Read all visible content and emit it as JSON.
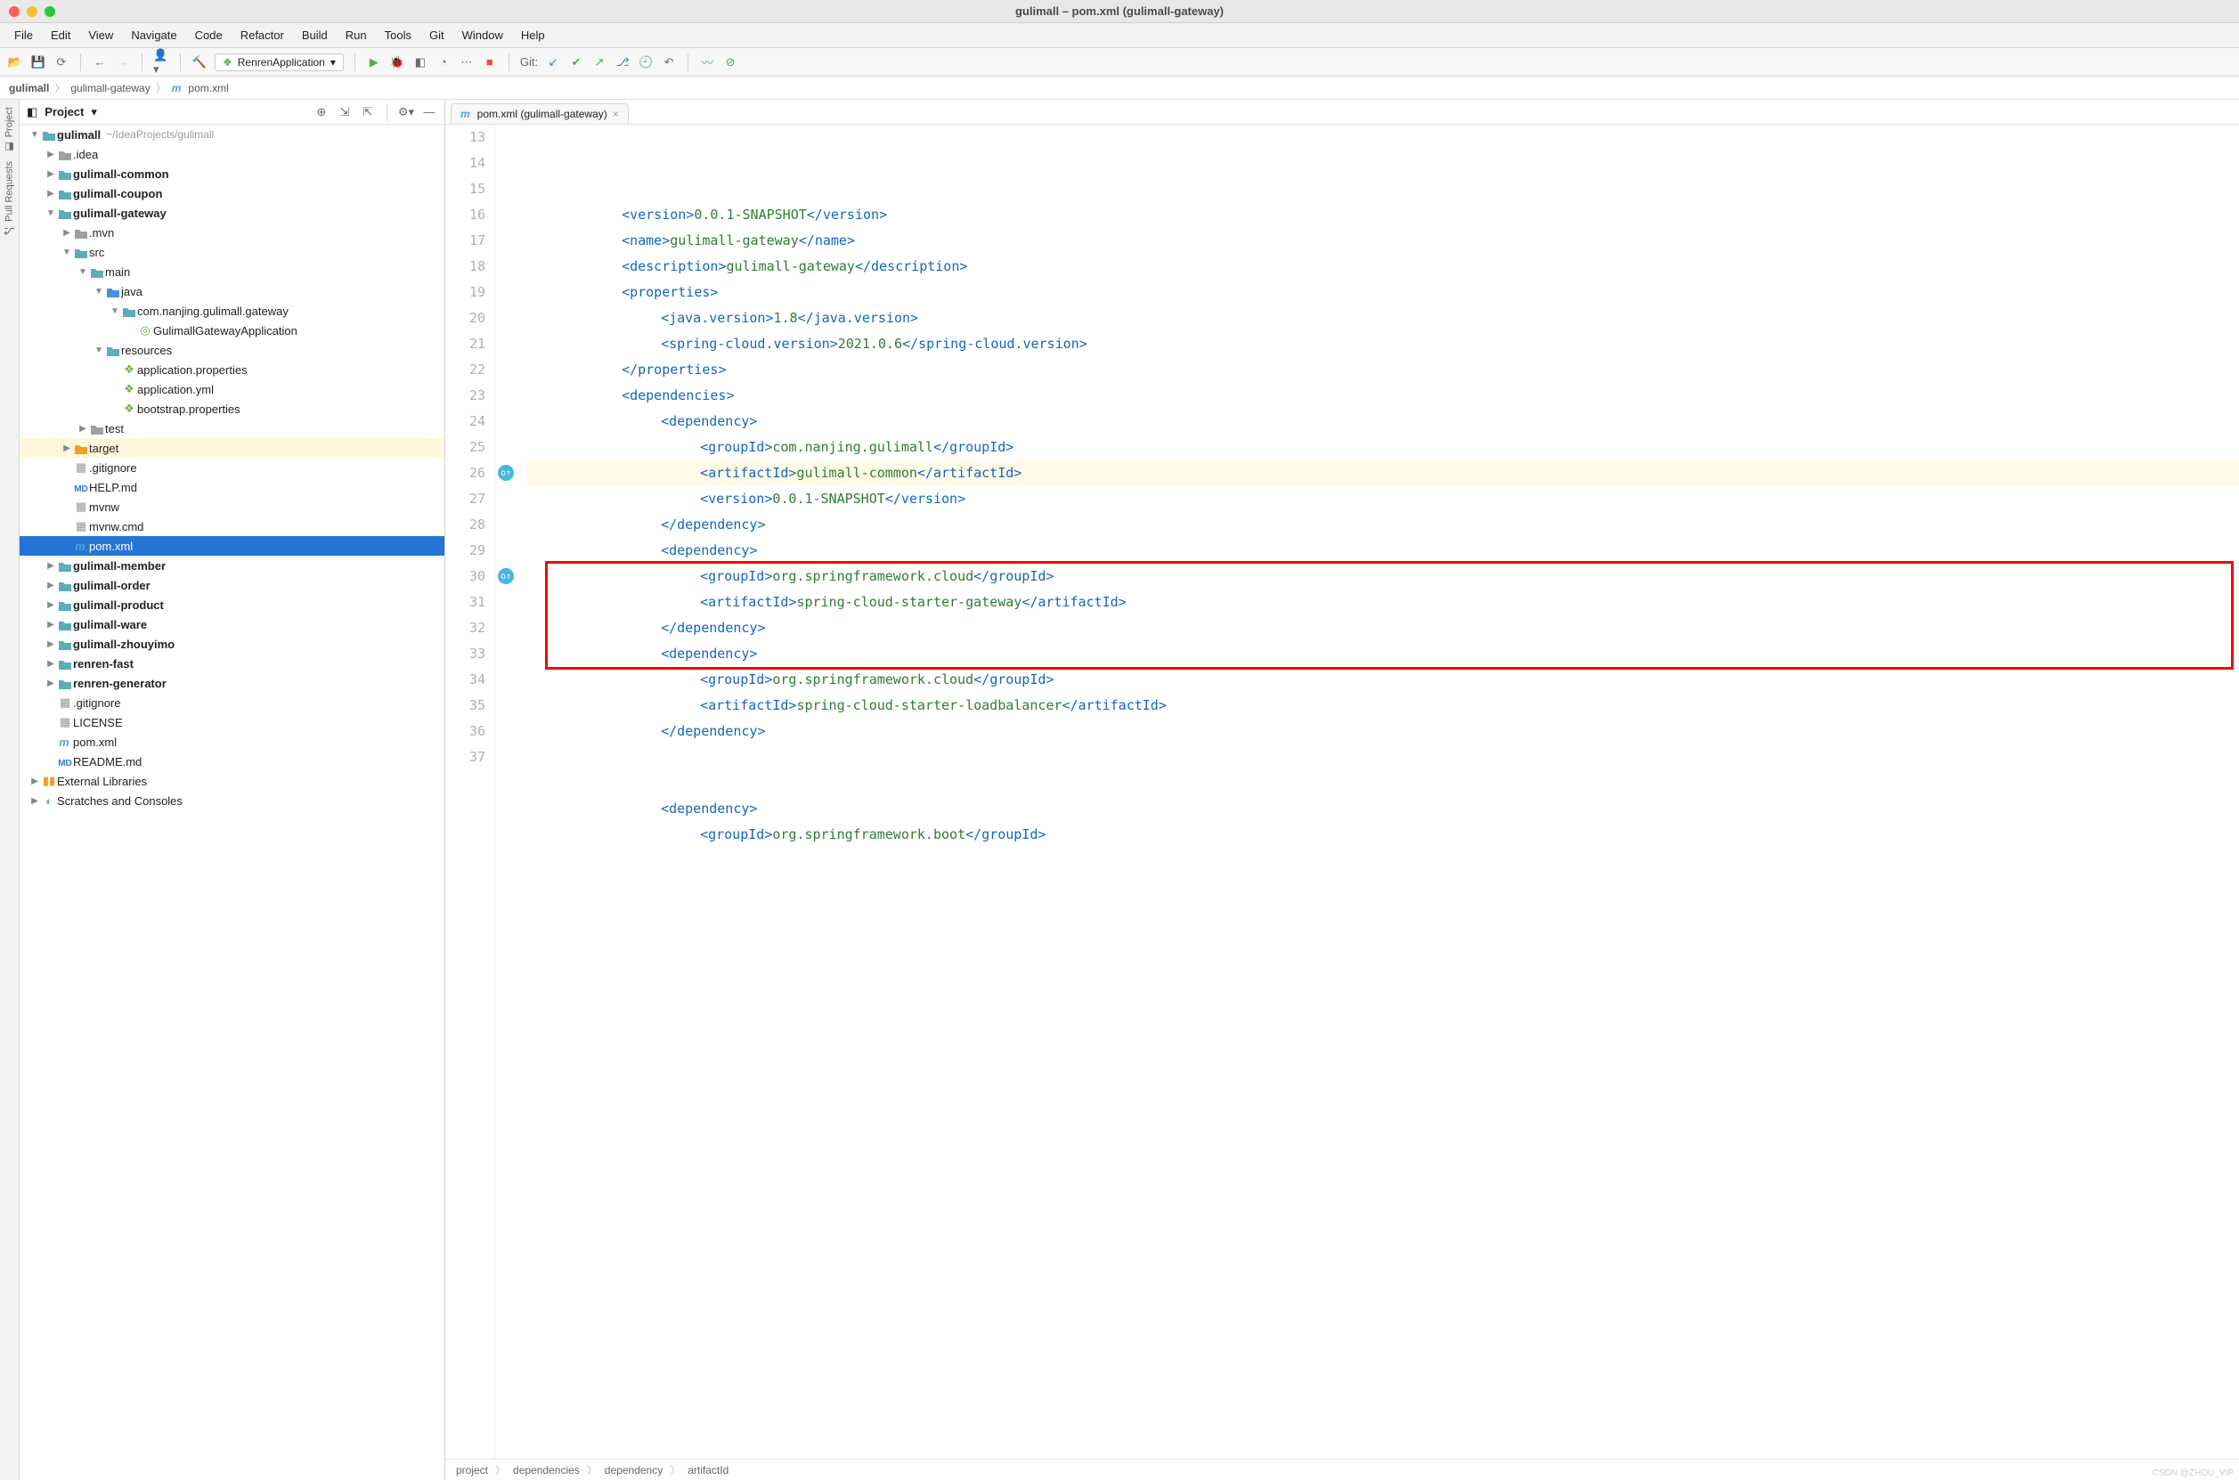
{
  "title": "gulimall – pom.xml (gulimall-gateway)",
  "menus": [
    "File",
    "Edit",
    "View",
    "Navigate",
    "Code",
    "Refactor",
    "Build",
    "Run",
    "Tools",
    "Git",
    "Window",
    "Help"
  ],
  "toolbar": {
    "run_config": "RenrenApplication",
    "git_label": "Git:"
  },
  "breadcrumb": {
    "root": "gulimall",
    "module": "gulimall-gateway",
    "file": "pom.xml"
  },
  "sidestrip": {
    "project": "Project",
    "pull": "Pull Requests"
  },
  "project_panel": {
    "title": "Project",
    "root": "gulimall",
    "root_path": "~/IdeaProjects/gulimall",
    "idea": ".idea",
    "gm_common": "gulimall-common",
    "gm_coupon": "gulimall-coupon",
    "gm_gateway": "gulimall-gateway",
    "mvn": ".mvn",
    "src": "src",
    "main": "main",
    "java": "java",
    "pkg": "com.nanjing.gulimall.gateway",
    "app_class": "GulimallGatewayApplication",
    "resources": "resources",
    "app_props": "application.properties",
    "app_yml": "application.yml",
    "boot_props": "bootstrap.properties",
    "test": "test",
    "target": "target",
    "gitignore": ".gitignore",
    "help_md": "HELP.md",
    "mvnw": "mvnw",
    "mvnw_cmd": "mvnw.cmd",
    "pom_sel": "pom.xml",
    "gm_member": "gulimall-member",
    "gm_order": "gulimall-order",
    "gm_product": "gulimall-product",
    "gm_ware": "gulimall-ware",
    "gm_zhouyimo": "gulimall-zhouyimo",
    "renren_fast": "renren-fast",
    "renren_gen": "renren-generator",
    "gitignore_root": ".gitignore",
    "license": "LICENSE",
    "pom_root": "pom.xml",
    "readme": "README.md",
    "ext_libs": "External Libraries",
    "scratches": "Scratches and Consoles"
  },
  "editor": {
    "tab_label": "pom.xml (gulimall-gateway)",
    "line_start": 13,
    "gutter_marks": [
      26,
      30
    ],
    "cursor_line": 23,
    "redbox": {
      "from": 30,
      "to": 33
    },
    "lines": [
      {
        "n": 13,
        "indent": 2,
        "parts": [
          {
            "a": "<"
          },
          {
            "t": "version"
          },
          {
            "a": ">"
          },
          {
            "x": "0.0.1-SNAPSHOT"
          },
          {
            "a": "</"
          },
          {
            "t": "version"
          },
          {
            "a": ">"
          }
        ]
      },
      {
        "n": 14,
        "indent": 2,
        "parts": [
          {
            "a": "<"
          },
          {
            "t": "name"
          },
          {
            "a": ">"
          },
          {
            "x": "gulimall-gateway"
          },
          {
            "a": "</"
          },
          {
            "t": "name"
          },
          {
            "a": ">"
          }
        ]
      },
      {
        "n": 15,
        "indent": 2,
        "parts": [
          {
            "a": "<"
          },
          {
            "t": "description"
          },
          {
            "a": ">"
          },
          {
            "x": "gulimall-gateway"
          },
          {
            "a": "</"
          },
          {
            "t": "description"
          },
          {
            "a": ">"
          }
        ]
      },
      {
        "n": 16,
        "indent": 2,
        "parts": [
          {
            "a": "<"
          },
          {
            "t": "properties"
          },
          {
            "a": ">"
          }
        ]
      },
      {
        "n": 17,
        "indent": 3,
        "parts": [
          {
            "a": "<"
          },
          {
            "t": "java.version"
          },
          {
            "a": ">"
          },
          {
            "x": "1.8"
          },
          {
            "a": "</"
          },
          {
            "t": "java.version"
          },
          {
            "a": ">"
          }
        ]
      },
      {
        "n": 18,
        "indent": 3,
        "parts": [
          {
            "a": "<"
          },
          {
            "t": "spring-cloud.version"
          },
          {
            "a": ">"
          },
          {
            "x": "2021.0.6"
          },
          {
            "a": "</"
          },
          {
            "t": "spring-cloud.version"
          },
          {
            "a": ">"
          }
        ]
      },
      {
        "n": 19,
        "indent": 2,
        "parts": [
          {
            "a": "</"
          },
          {
            "t": "properties"
          },
          {
            "a": ">"
          }
        ]
      },
      {
        "n": 20,
        "indent": 2,
        "parts": [
          {
            "a": "<"
          },
          {
            "t": "dependencies"
          },
          {
            "a": ">"
          }
        ]
      },
      {
        "n": 21,
        "indent": 3,
        "parts": [
          {
            "a": "<"
          },
          {
            "t": "dependency"
          },
          {
            "a": ">"
          }
        ]
      },
      {
        "n": 22,
        "indent": 4,
        "parts": [
          {
            "a": "<"
          },
          {
            "t": "groupId"
          },
          {
            "a": ">"
          },
          {
            "x": "com.nanjing.gulimall"
          },
          {
            "a": "</"
          },
          {
            "t": "groupId"
          },
          {
            "a": ">"
          }
        ]
      },
      {
        "n": 23,
        "indent": 4,
        "parts": [
          {
            "a": "<"
          },
          {
            "t": "artifactId"
          },
          {
            "a": ">"
          },
          {
            "x": "gulimall-common"
          },
          {
            "a": "</"
          },
          {
            "t": "artifactId"
          },
          {
            "a": ">"
          }
        ]
      },
      {
        "n": 24,
        "indent": 4,
        "parts": [
          {
            "a": "<"
          },
          {
            "t": "version"
          },
          {
            "a": ">"
          },
          {
            "x": "0.0.1-SNAPSHOT"
          },
          {
            "a": "</"
          },
          {
            "t": "version"
          },
          {
            "a": ">"
          }
        ]
      },
      {
        "n": 25,
        "indent": 3,
        "parts": [
          {
            "a": "</"
          },
          {
            "t": "dependency"
          },
          {
            "a": ">"
          }
        ]
      },
      {
        "n": 26,
        "indent": 3,
        "parts": [
          {
            "a": "<"
          },
          {
            "t": "dependency"
          },
          {
            "a": ">"
          }
        ]
      },
      {
        "n": 27,
        "indent": 4,
        "parts": [
          {
            "a": "<"
          },
          {
            "t": "groupId"
          },
          {
            "a": ">"
          },
          {
            "x": "org.springframework.cloud"
          },
          {
            "a": "</"
          },
          {
            "t": "groupId"
          },
          {
            "a": ">"
          }
        ]
      },
      {
        "n": 28,
        "indent": 4,
        "parts": [
          {
            "a": "<"
          },
          {
            "t": "artifactId"
          },
          {
            "a": ">"
          },
          {
            "x": "spring-cloud-starter-gateway"
          },
          {
            "a": "</"
          },
          {
            "t": "artifactId"
          },
          {
            "a": ">"
          }
        ]
      },
      {
        "n": 29,
        "indent": 3,
        "parts": [
          {
            "a": "</"
          },
          {
            "t": "dependency"
          },
          {
            "a": ">"
          }
        ]
      },
      {
        "n": 30,
        "indent": 3,
        "parts": [
          {
            "a": "<"
          },
          {
            "t": "dependency"
          },
          {
            "a": ">"
          }
        ]
      },
      {
        "n": 31,
        "indent": 4,
        "parts": [
          {
            "a": "<"
          },
          {
            "t": "groupId"
          },
          {
            "a": ">"
          },
          {
            "x": "org.springframework.cloud"
          },
          {
            "a": "</"
          },
          {
            "t": "groupId"
          },
          {
            "a": ">"
          }
        ]
      },
      {
        "n": 32,
        "indent": 4,
        "parts": [
          {
            "a": "<"
          },
          {
            "t": "artifactId"
          },
          {
            "a": ">"
          },
          {
            "x": "spring-cloud-starter-loadbalancer"
          },
          {
            "a": "</"
          },
          {
            "t": "artifactId"
          },
          {
            "a": ">"
          }
        ]
      },
      {
        "n": 33,
        "indent": 3,
        "parts": [
          {
            "a": "</"
          },
          {
            "t": "dependency"
          },
          {
            "a": ">"
          }
        ]
      },
      {
        "n": 34,
        "indent": 0,
        "parts": []
      },
      {
        "n": 35,
        "indent": 0,
        "parts": []
      },
      {
        "n": 36,
        "indent": 3,
        "parts": [
          {
            "a": "<"
          },
          {
            "t": "dependency"
          },
          {
            "a": ">"
          }
        ]
      },
      {
        "n": 37,
        "indent": 4,
        "parts": [
          {
            "a": "<"
          },
          {
            "t": "groupId"
          },
          {
            "a": ">"
          },
          {
            "x": "org.springframework.boot"
          },
          {
            "a": "</"
          },
          {
            "t": "groupId"
          },
          {
            "a": ">"
          }
        ]
      }
    ],
    "crumbs": [
      "project",
      "dependencies",
      "dependency",
      "artifactId"
    ],
    "watermark": "CSDN @ZHOU_VIP"
  }
}
